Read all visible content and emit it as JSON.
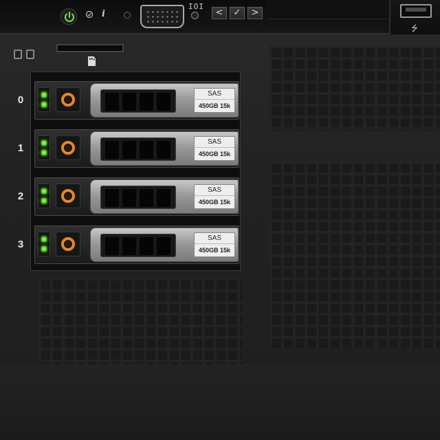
{
  "front_panel": {
    "vga_label": "IOI",
    "usb_symbol": "⭍",
    "info_symbol": "i",
    "lcd_buttons": [
      "<",
      "✓",
      ">"
    ]
  },
  "drive_bays": [
    {
      "number": "0",
      "interface": "SAS",
      "spec": "450GB 15k"
    },
    {
      "number": "1",
      "interface": "SAS",
      "spec": "450GB 15k"
    },
    {
      "number": "2",
      "interface": "SAS",
      "spec": "450GB 15k"
    },
    {
      "number": "3",
      "interface": "SAS",
      "spec": "450GB 15k"
    }
  ],
  "colors": {
    "status_led": "#5ed62a",
    "release_ring": "#e28a2a",
    "chassis": "#222222"
  },
  "icons": {
    "power": "power-icon",
    "diagnostics": "diagnostics-icon",
    "info": "info-icon",
    "usb": "usb-icon",
    "sd_card": "sd-card-icon"
  }
}
